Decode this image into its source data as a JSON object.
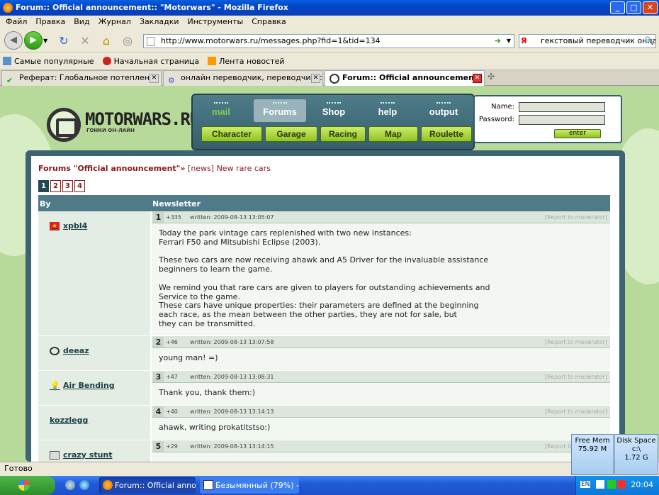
{
  "window": {
    "title": "Forum:: Official announcement:: \"Motorwars\" - Mozilla Firefox"
  },
  "menu": [
    "Файл",
    "Правка",
    "Вид",
    "Журнал",
    "Закладки",
    "Инструменты",
    "Справка"
  ],
  "nav": {
    "url": "http://www.motorwars.ru/messages.php?fid=1&tid=134",
    "search": "гекстовый переводчик онлайн",
    "search_engine_letter": "Я"
  },
  "bookmarks": [
    "Самые популярные",
    "Начальная страница",
    "Лента новостей"
  ],
  "tabs": [
    {
      "label": "Реферат: Глобальное потепление - \"..."
    },
    {
      "label": "онлайн переводчик, переводчик с а..."
    },
    {
      "label": "Forum:: Official announcement: \"..."
    }
  ],
  "site": {
    "logo": "MOTORWARS.RU",
    "logo_sub": "ГОНКИ ОН-ЛАЙН",
    "top_nav": [
      "mail",
      "Forums",
      "Shop",
      "help",
      "output"
    ],
    "sub_nav": [
      "Character",
      "Garage",
      "Racing",
      "Map",
      "Roulette"
    ],
    "login": {
      "name_label": "Name:",
      "password_label": "Password:",
      "enter_label": "enter"
    }
  },
  "forum": {
    "crumb_bold": "Forums \"Official announcement\"",
    "crumb_sep": "»",
    "crumb_rest": " [news] New rare cars",
    "pages": [
      "1",
      "2",
      "3",
      "4"
    ],
    "col_by": "By",
    "col_news": "Newsletter",
    "report": "[Report to moderator]",
    "posts": [
      {
        "num": "1",
        "user": "xpbl4",
        "score": "+335",
        "date": "written: 2009-08-13 13:05:07",
        "text": "Today the park vintage cars replenished with two new instances:\nFerrari F50 and Mitsubishi Eclipse (2003).\n\nThese two cars are now receiving ahawk and A5 Driver for the invaluable assistance\nbeginners to learn the game.\n\nWe remind you that rare cars are given to players for outstanding achievements and\nService to the game.\nThese cars have unique properties: their parameters are defined at the beginning\neach race, as the mean between the other parties, they are not for sale, but\nthey can be transmitted."
      },
      {
        "num": "2",
        "user": "deeaz",
        "score": "+46",
        "date": "written: 2009-08-13 13:07:58",
        "text": "young man! =)"
      },
      {
        "num": "3",
        "user": "Air Bending",
        "score": "+47",
        "date": "written: 2009-08-13 13:08:31",
        "text": "Thank you, thank them:)"
      },
      {
        "num": "4",
        "user": "kozzlegg",
        "score": "+40",
        "date": "written: 2009-08-13 13:14:13",
        "text": "ahawk, writing prokatitstso:)"
      },
      {
        "num": "5",
        "user": "crazy stunt",
        "score": "+29",
        "date": "written: 2009-08-13 13:14:15",
        "text": ""
      }
    ]
  },
  "status": "Готово",
  "widgets": {
    "mem_label": "Free Mem",
    "mem_value": "75.92 M",
    "disk_label": "Disk Space",
    "disk_path": "c:\\",
    "disk_value": "1.72 G"
  },
  "taskbar": {
    "items": [
      "Forum:: Official anno...",
      "Безымянный (79%) -..."
    ],
    "lang": "EN",
    "clock": "20:04"
  }
}
